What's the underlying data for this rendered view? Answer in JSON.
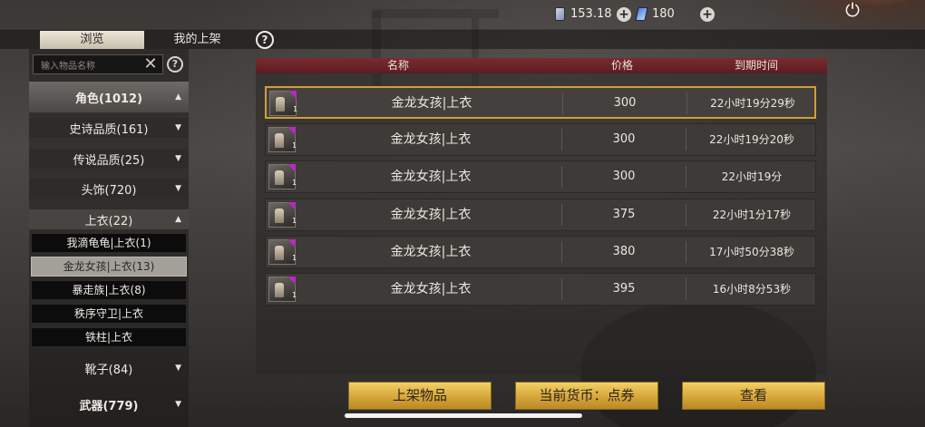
{
  "topbar": {
    "currency1_value": "153.18",
    "currency2_value": "180",
    "plus_label": "+",
    "power_icon": "⏻"
  },
  "tabs": {
    "browse": "浏览",
    "my_listings": "我的上架",
    "help": "?"
  },
  "sidebar": {
    "search_placeholder": "输入物品名称",
    "clear": "✕",
    "help": "?",
    "categories": {
      "role": "角色(1012)",
      "epic": "史诗品质(161)",
      "legendary": "传说品质(25)",
      "headwear": "头饰(720)",
      "tops": "上衣(22)",
      "boots": "靴子(84)",
      "weapons": "武器(779)"
    },
    "tops_items": [
      "我滴龟龟|上衣(1)",
      "金龙女孩|上衣(13)",
      "暴走族|上衣(8)",
      "秩序守卫|上衣",
      "铁柱|上衣"
    ]
  },
  "table": {
    "headers": {
      "name": "名称",
      "price": "价格",
      "expire": "到期时间"
    },
    "rows": [
      {
        "name": "金龙女孩|上衣",
        "qty": "1",
        "price": "300",
        "expire": "22小时19分29秒"
      },
      {
        "name": "金龙女孩|上衣",
        "qty": "1",
        "price": "300",
        "expire": "22小时19分20秒"
      },
      {
        "name": "金龙女孩|上衣",
        "qty": "1",
        "price": "300",
        "expire": "22小时19分"
      },
      {
        "name": "金龙女孩|上衣",
        "qty": "1",
        "price": "375",
        "expire": "22小时1分17秒"
      },
      {
        "name": "金龙女孩|上衣",
        "qty": "1",
        "price": "380",
        "expire": "17小时50分38秒"
      },
      {
        "name": "金龙女孩|上衣",
        "qty": "1",
        "price": "395",
        "expire": "16小时8分53秒"
      }
    ]
  },
  "buttons": {
    "list_item": "上架物品",
    "currency": "当前货币：点券",
    "view": "查看"
  },
  "colors": {
    "header_red": "#7c2a2e",
    "highlight_gold": "#d39d3a",
    "rarity_purple": "#b02fb6",
    "button_gold": "#d7a63a"
  }
}
